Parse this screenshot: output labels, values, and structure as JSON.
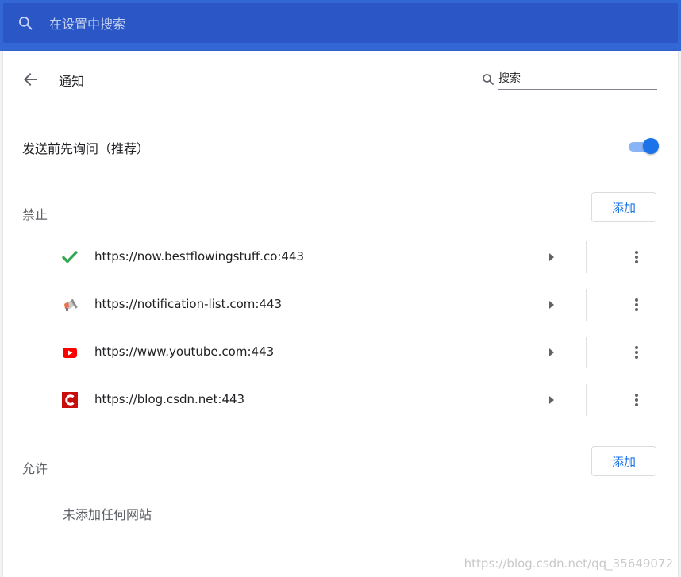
{
  "topbar": {
    "search_placeholder": "在设置中搜索",
    "search_icon": "search-icon"
  },
  "page": {
    "title": "通知",
    "back_icon": "arrow-back-icon",
    "search_placeholder": "搜索"
  },
  "ask_before_sending": {
    "label": "发送前先询问（推荐）",
    "enabled": true
  },
  "block_section": {
    "label": "禁止",
    "add_label": "添加",
    "sites": [
      {
        "url": "https://now.bestflowingstuff.co:443",
        "icon": "checkmark-icon"
      },
      {
        "url": "https://notification-list.com:443",
        "icon": "megaphone-icon"
      },
      {
        "url": "https://www.youtube.com:443",
        "icon": "youtube-icon"
      },
      {
        "url": "https://blog.csdn.net:443",
        "icon": "csdn-icon"
      }
    ]
  },
  "allow_section": {
    "label": "允许",
    "add_label": "添加",
    "empty_text": "未添加任何网站"
  },
  "watermark": "https://blog.csdn.net/qq_35649072",
  "colors": {
    "header_bar": "#3367d6",
    "header_search": "#2a56c6",
    "accent": "#1a73e8"
  }
}
